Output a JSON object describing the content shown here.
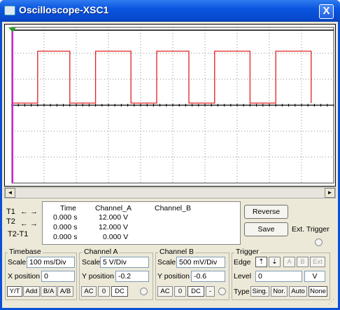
{
  "window": {
    "title": "Oscilloscope-XSC1",
    "close_label": "X"
  },
  "cursors": {
    "t1_label": "T1",
    "t2_label": "T2",
    "t2t1_label": "T2-T1",
    "left_arrow": "←",
    "right_arrow": "→"
  },
  "readout": {
    "headers": [
      "Time",
      "Channel_A",
      "Channel_B"
    ],
    "rows": [
      {
        "time": "0.000 s",
        "a": "12.000  V",
        "b": ""
      },
      {
        "time": "0.000 s",
        "a": "12.000  V",
        "b": ""
      },
      {
        "time": "0.000 s",
        "a": "0.000  V",
        "b": ""
      }
    ]
  },
  "buttons": {
    "reverse": "Reverse",
    "save": "Save",
    "ext_trigger": "Ext. Trigger"
  },
  "timebase": {
    "title": "Timebase",
    "scale_label": "Scale",
    "scale_value": "100 ms/Div",
    "xpos_label": "X position",
    "xpos_value": "0",
    "modes": [
      "Y/T",
      "Add",
      "B/A",
      "A/B"
    ]
  },
  "channel_a": {
    "title": "Channel A",
    "scale_label": "Scale",
    "scale_value": "5  V/Div",
    "ypos_label": "Y position",
    "ypos_value": "-0.2",
    "coupling": [
      "AC",
      "0",
      "DC"
    ]
  },
  "channel_b": {
    "title": "Channel B",
    "scale_label": "Scale",
    "scale_value": "500 mV/Div",
    "ypos_label": "Y position",
    "ypos_value": "-0.6",
    "coupling": [
      "AC",
      "0",
      "DC",
      "-"
    ]
  },
  "trigger": {
    "title": "Trigger",
    "edge_label": "Edge",
    "edge_buttons": [
      "A",
      "B",
      "Ext"
    ],
    "level_label": "Level",
    "level_value": "0",
    "level_unit": "V",
    "type_label": "Type",
    "types": [
      "Sing.",
      "Nor.",
      "Auto",
      "None"
    ]
  },
  "chart_data": {
    "type": "line",
    "xlabel": "",
    "ylabel": "",
    "xlim": [
      0,
      1000
    ],
    "series": [
      {
        "color": "#e02020",
        "x": [
          0,
          80,
          80,
          180,
          180,
          260,
          260,
          370,
          370,
          450,
          450,
          550,
          550,
          630,
          630,
          740,
          740,
          820,
          820,
          930,
          930
        ],
        "y": [
          0,
          0,
          12,
          12,
          0,
          0,
          12,
          12,
          0,
          0,
          12,
          12,
          0,
          0,
          12,
          12,
          0,
          0,
          12,
          12,
          0
        ]
      }
    ],
    "colors": {
      "screen_bg": "#ffffff",
      "grid": "#8c8c8c",
      "trace_a": "#e02020",
      "trace_b": "#000000",
      "cursor1": "#d81ee0",
      "cursor2": "#2050c0"
    }
  }
}
